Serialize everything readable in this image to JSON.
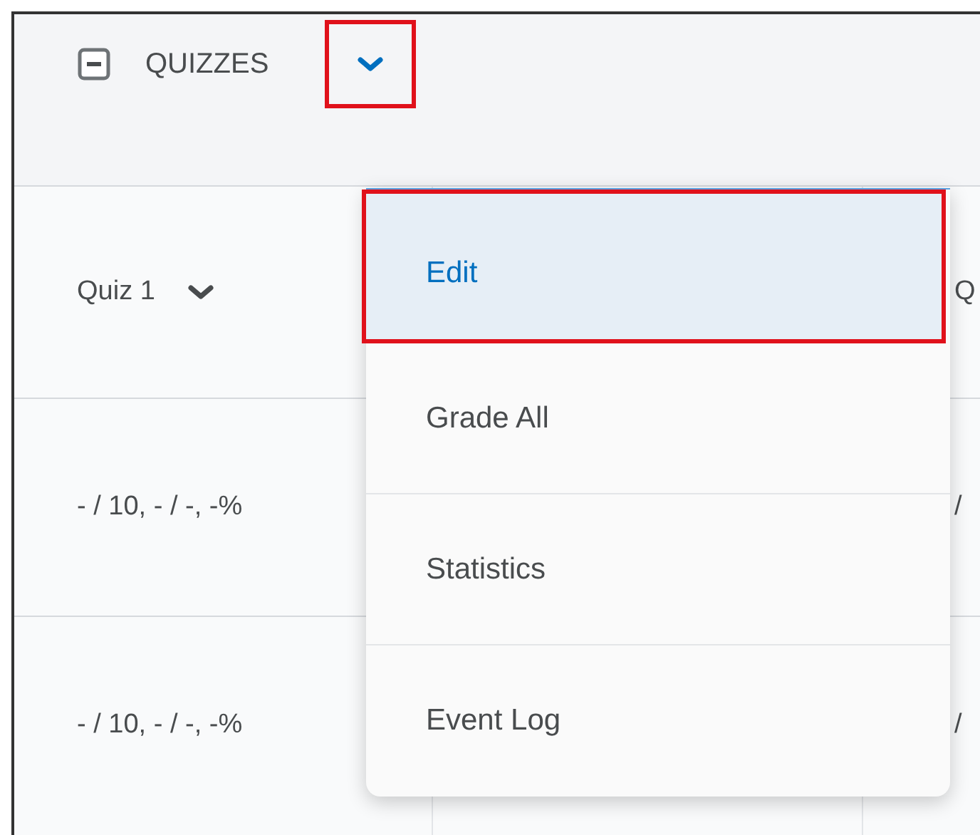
{
  "section": {
    "title": "QUIZZES",
    "expanded": true,
    "menu_open": true
  },
  "columns": [
    {
      "label": "Quiz 1"
    },
    {
      "label": "Q"
    }
  ],
  "rows": [
    {
      "cells": [
        "- / 10, - / -, -%",
        "/"
      ]
    },
    {
      "cells": [
        "- / 10, - / -, -%",
        "/"
      ]
    }
  ],
  "menu": [
    {
      "label": "Edit",
      "selected": true
    },
    {
      "label": "Grade All",
      "selected": false
    },
    {
      "label": "Statistics",
      "selected": false
    },
    {
      "label": "Event Log",
      "selected": false
    }
  ]
}
